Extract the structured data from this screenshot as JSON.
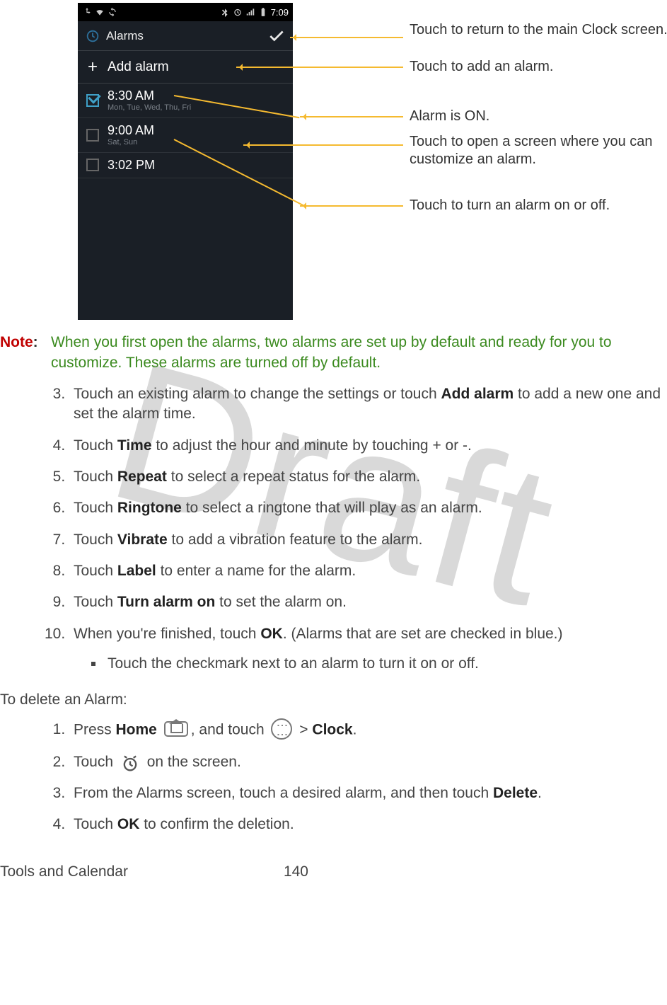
{
  "watermark": "Draft",
  "phone": {
    "status_time": "7:09",
    "title": "Alarms",
    "add_label": "Add alarm",
    "alarms": [
      {
        "time": "8:30 AM",
        "days": "Mon, Tue, Wed, Thu, Fri",
        "on": true
      },
      {
        "time": "9:00 AM",
        "days": "Sat, Sun",
        "on": false
      },
      {
        "time": "3:02 PM",
        "days": "",
        "on": false
      }
    ]
  },
  "callouts": {
    "c1": "Touch to return to the main Clock screen.",
    "c2": "Touch to add an alarm.",
    "c3": "Alarm is ON.",
    "c4": "Touch to open a screen where you can customize an alarm.",
    "c5": "Touch to turn an alarm on or off."
  },
  "note": {
    "label": "Note",
    "body": "When you first open the alarms, two alarms are set up by default and ready for you to customize. These alarms are turned off by default."
  },
  "steps": {
    "s3a": "Touch an existing alarm to change the settings or touch ",
    "s3b": "Add alarm",
    "s3c": " to add a new one and set the alarm time.",
    "s4a": "Touch ",
    "s4b": "Time",
    "s4c": " to adjust the hour and minute by touching + or -.",
    "s5a": "Touch ",
    "s5b": "Repeat",
    "s5c": " to select a repeat status for the alarm.",
    "s6a": "Touch ",
    "s6b": "Ringtone",
    "s6c": " to select a ringtone that will play as an alarm.",
    "s7a": "Touch ",
    "s7b": "Vibrate",
    "s7c": " to add a vibration feature to the alarm.",
    "s8a": "Touch ",
    "s8b": "Label",
    "s8c": " to enter a name for the alarm.",
    "s9a": "Touch ",
    "s9b": "Turn alarm on",
    "s9c": " to set the alarm on.",
    "s10a": "When you're finished, touch ",
    "s10b": "OK",
    "s10c": ". (Alarms that are set are checked in blue.)",
    "sub1": "Touch the checkmark next to an alarm to turn it on or off."
  },
  "delete": {
    "heading": "To delete an Alarm:",
    "d1a": "Press ",
    "d1b": "Home",
    "d1c": ", and touch ",
    "d1d": " > ",
    "d1e": "Clock",
    "d1f": ".",
    "d2a": "Touch ",
    "d2b": " on the screen.",
    "d3a": "From the Alarms screen, touch a desired alarm, and then touch ",
    "d3b": "Delete",
    "d3c": ".",
    "d4a": "Touch ",
    "d4b": "OK",
    "d4c": " to confirm the deletion."
  },
  "footer": {
    "section": "Tools and Calendar",
    "page": "140"
  }
}
